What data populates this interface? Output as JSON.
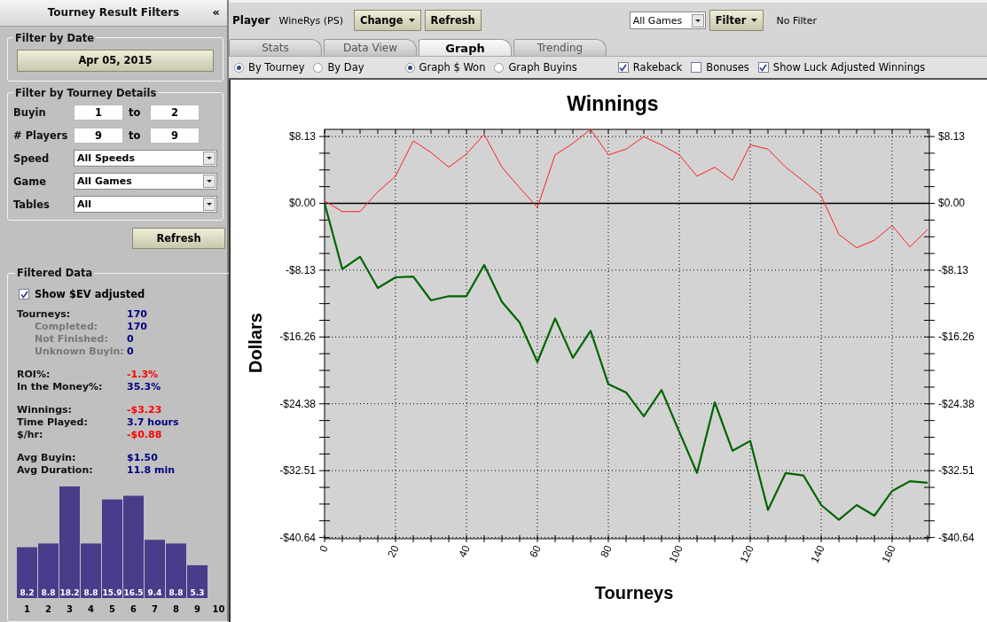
{
  "sidebar": {
    "title": "Tourney Result Filters",
    "collapse": "«",
    "date_filter": {
      "legend": "Filter by Date",
      "date": "Apr 05, 2015"
    },
    "details_filter": {
      "legend": "Filter by Tourney Details",
      "ranges": [
        {
          "label": "Buyin",
          "from": "1",
          "separator": "to",
          "to": "2"
        },
        {
          "label": "# Players",
          "from": "9",
          "separator": "to",
          "to": "9"
        }
      ],
      "dropdowns": [
        {
          "label": "Speed",
          "value": "All Speeds"
        },
        {
          "label": "Game",
          "value": "All Games"
        },
        {
          "label": "Tables",
          "value": "All"
        }
      ]
    },
    "refresh": "Refresh",
    "filtered_data": {
      "legend": "Filtered Data",
      "ev_checkbox": {
        "label": "Show $EV adjusted",
        "checked": true
      },
      "groups": [
        [
          {
            "label": "Tourneys:",
            "value": "170",
            "kind": "main",
            "color": "#000080"
          },
          {
            "label": "Completed:",
            "value": "170",
            "kind": "sub",
            "color": "#000080"
          },
          {
            "label": "Not Finished:",
            "value": "0",
            "kind": "sub",
            "color": "#000080"
          },
          {
            "label": "Unknown Buyin:",
            "value": "0",
            "kind": "sub",
            "color": "#000080"
          }
        ],
        [
          {
            "label": "ROI%:",
            "value": "-1.3%",
            "kind": "main",
            "color": "#ff0000"
          },
          {
            "label": "In the Money%:",
            "value": "35.3%",
            "kind": "main",
            "color": "#000080"
          }
        ],
        [
          {
            "label": "Winnings:",
            "value": "-$3.23",
            "kind": "main",
            "color": "#ff0000"
          },
          {
            "label": "Time Played:",
            "value": "3.7 hours",
            "kind": "main",
            "color": "#000080"
          },
          {
            "label": "$/hr:",
            "value": "-$0.88",
            "kind": "main",
            "color": "#ff0000"
          }
        ],
        [
          {
            "label": "Avg Buyin:",
            "value": "$1.50",
            "kind": "main",
            "color": "#000080"
          },
          {
            "label": "Avg Duration:",
            "value": "11.8 min",
            "kind": "main",
            "color": "#000080"
          }
        ]
      ],
      "chart_data": {
        "type": "bar",
        "categories": [
          "1",
          "2",
          "3",
          "4",
          "5",
          "6",
          "7",
          "8",
          "9",
          "10"
        ],
        "series": [
          {
            "color": "#483d8b",
            "values": [
              8.2,
              8.8,
              18.2,
              8.8,
              15.9,
              16.5,
              9.4,
              8.8,
              5.3,
              null
            ]
          }
        ],
        "data_labels": true
      }
    }
  },
  "toolbar": {
    "player_label": "Player",
    "player": "WineRys (PS)",
    "change": "Change",
    "refresh": "Refresh",
    "game_select": "All Games",
    "filter": "Filter",
    "filter_status": "No Filter"
  },
  "tabs": [
    {
      "label": "Stats",
      "selected": false
    },
    {
      "label": "Data View",
      "selected": false
    },
    {
      "label": "Graph",
      "selected": true
    },
    {
      "label": "Trending",
      "selected": false
    }
  ],
  "options": {
    "group_by": [
      {
        "label": "By Tourney",
        "selected": true
      },
      {
        "label": "By Day",
        "selected": false
      }
    ],
    "graph_of": [
      {
        "label": "Graph $ Won",
        "selected": true
      },
      {
        "label": "Graph Buyins",
        "selected": false
      }
    ],
    "checkboxes": [
      {
        "label": "Rakeback",
        "checked": true
      },
      {
        "label": "Bonuses",
        "checked": false
      },
      {
        "label": "Show Luck Adjusted Winnings",
        "checked": true
      }
    ]
  },
  "chart": {
    "chart_data": {
      "type": "line",
      "title": "Winnings",
      "xlabel": "Tourneys",
      "ylabel": "Dollars",
      "x": [
        0,
        5,
        10,
        15,
        20,
        25,
        30,
        35,
        40,
        45,
        50,
        55,
        60,
        65,
        70,
        75,
        80,
        85,
        90,
        95,
        100,
        105,
        110,
        115,
        120,
        125,
        130,
        135,
        140,
        145,
        150,
        155,
        160,
        165,
        170
      ],
      "series": [
        {
          "color": "#ff2020",
          "values": [
            0.3,
            -1.0,
            -1.0,
            1.4,
            3.3,
            7.6,
            6.2,
            4.4,
            6.0,
            8.4,
            4.4,
            1.9,
            -0.5,
            5.9,
            7.3,
            9.0,
            5.9,
            6.6,
            8.1,
            7.1,
            5.9,
            3.3,
            4.4,
            2.8,
            7.1,
            6.6,
            4.4,
            2.7,
            0.9,
            -3.8,
            -5.4,
            -4.5,
            -2.7,
            -5.3,
            -3.2
          ]
        },
        {
          "color": "#006400",
          "values": [
            0,
            -8.0,
            -6.5,
            -10.3,
            -9.0,
            -8.9,
            -11.8,
            -11.3,
            -11.3,
            -7.5,
            -12.0,
            -14.5,
            -19.3,
            -14.0,
            -18.8,
            -15.5,
            -22.0,
            -23.0,
            -25.9,
            -22.7,
            -27.8,
            -32.8,
            -24.2,
            -30.1,
            -28.9,
            -37.3,
            -32.8,
            -33.1,
            -36.7,
            -38.5,
            -36.7,
            -38.0,
            -35.0,
            -33.8,
            -34.0
          ]
        }
      ],
      "grid": true,
      "xlim": [
        0,
        170.5
      ],
      "ylim": [
        -40.8,
        9.0
      ],
      "xticks": [
        0,
        20,
        40,
        60,
        80,
        100,
        120,
        140,
        160
      ],
      "yticks": [
        {
          "value": 8.13,
          "label": "$8.13"
        },
        {
          "value": 0,
          "label": "$0.00"
        },
        {
          "value": -8.13,
          "label": "-$8.13"
        },
        {
          "value": -16.26,
          "label": "-$16.26"
        },
        {
          "value": -24.38,
          "label": "-$24.38"
        },
        {
          "value": -32.51,
          "label": "-$32.51"
        },
        {
          "value": -40.64,
          "label": "-$40.64"
        }
      ]
    }
  }
}
